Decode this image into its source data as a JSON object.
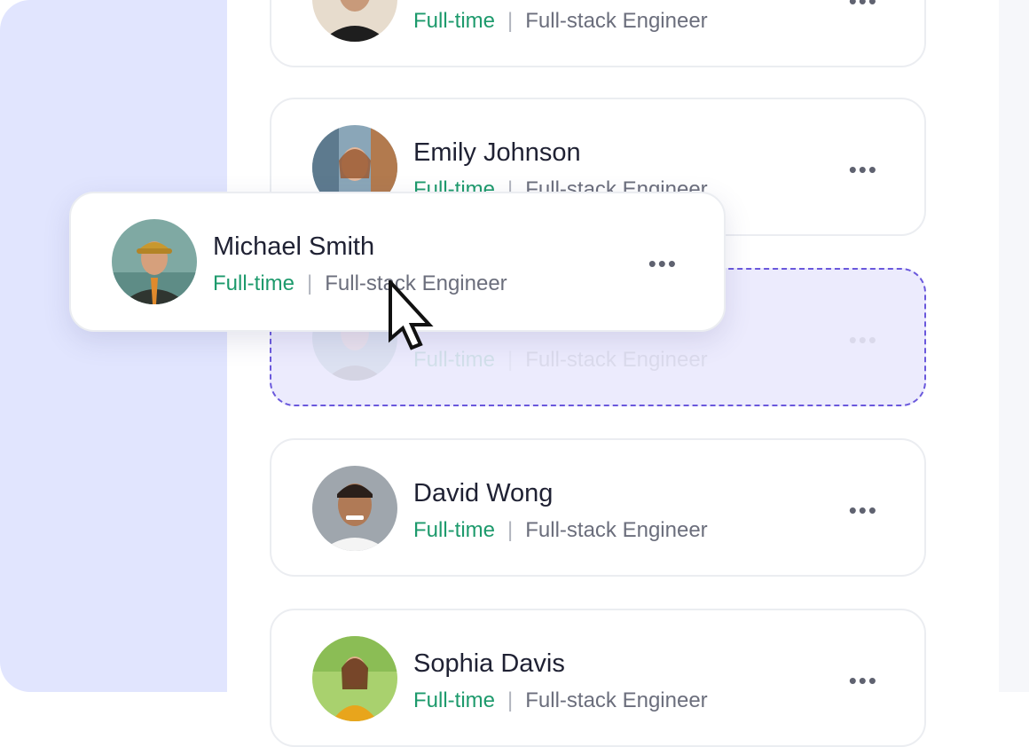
{
  "cards": [
    {
      "name": "",
      "employment": "Full-time",
      "role": "Full-stack Engineer",
      "more": "•••"
    },
    {
      "name": "Emily Johnson",
      "employment": "Full-time",
      "role": "Full-stack Engineer",
      "more": "•••"
    },
    {
      "name": "",
      "employment": "Full-time",
      "role": "Full-stack Engineer",
      "more": "•••"
    },
    {
      "name": "David Wong",
      "employment": "Full-time",
      "role": "Full-stack Engineer",
      "more": "•••"
    },
    {
      "name": "Sophia Davis",
      "employment": "Full-time",
      "role": "Full-stack Engineer",
      "more": "•••"
    }
  ],
  "dragging": {
    "name": "Michael Smith",
    "employment": "Full-time",
    "role": "Full-stack Engineer",
    "more": "•••"
  },
  "divider": "|",
  "colors": {
    "sidebar": "#e1e5fe",
    "employment": "#1d9a6c",
    "placeholder_fill": "#ecebfd",
    "placeholder_border": "#6a58dc"
  },
  "icons": {
    "more": "more-horizontal-icon",
    "cursor": "arrow-cursor-icon"
  }
}
